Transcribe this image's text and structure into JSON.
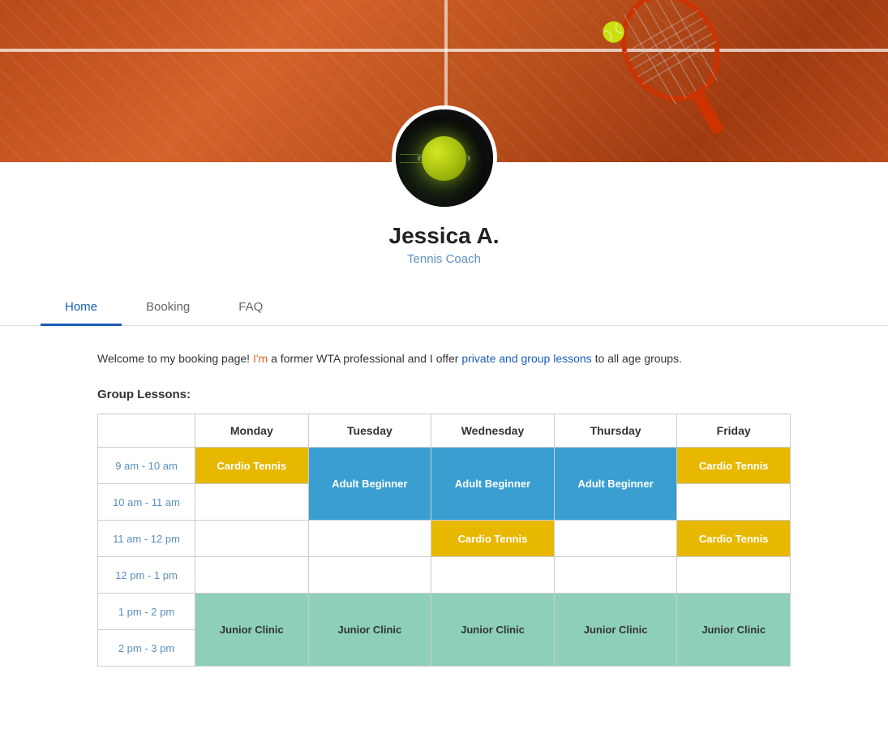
{
  "banner": {
    "alt": "Tennis clay court with racket"
  },
  "profile": {
    "name": "Jessica A.",
    "title": "Tennis Coach"
  },
  "nav": {
    "tabs": [
      {
        "id": "home",
        "label": "Home",
        "active": true
      },
      {
        "id": "booking",
        "label": "Booking",
        "active": false
      },
      {
        "id": "faq",
        "label": "FAQ",
        "active": false
      }
    ]
  },
  "content": {
    "welcome": {
      "prefix": "Welcome to my booking page!",
      "highlight1": " I'm",
      "middle": " a former WTA professional and I offer ",
      "highlight2": "private and group lessons",
      "suffix": " to all age groups."
    },
    "group_lessons_title": "Group Lessons:",
    "schedule": {
      "columns": [
        "",
        "Monday",
        "Tuesday",
        "Wednesday",
        "Thursday",
        "Friday"
      ],
      "rows": [
        {
          "time": "9 am - 10 am",
          "cells": [
            "cardio",
            "adult_top",
            "adult_top",
            "adult_top",
            "cardio"
          ]
        },
        {
          "time": "10 am - 11 am",
          "cells": [
            "empty",
            "adult_bottom",
            "adult_bottom",
            "adult_bottom",
            "empty"
          ]
        },
        {
          "time": "11 am - 12 pm",
          "cells": [
            "empty",
            "empty",
            "cardio",
            "empty",
            "cardio"
          ]
        },
        {
          "time": "12 pm - 1 pm",
          "cells": [
            "empty",
            "empty",
            "empty",
            "empty",
            "empty"
          ]
        },
        {
          "time": "1 pm - 2 pm",
          "cells": [
            "junior_top",
            "junior_top",
            "junior_top",
            "junior_top",
            "junior_top"
          ]
        },
        {
          "time": "2 pm - 3 pm",
          "cells": [
            "junior_bottom",
            "junior_bottom",
            "junior_bottom",
            "junior_bottom",
            "junior_bottom"
          ]
        }
      ],
      "labels": {
        "cardio": "Cardio Tennis",
        "adult_beginner": "Adult Beginner",
        "junior_clinic": "Junior Clinic"
      }
    }
  }
}
